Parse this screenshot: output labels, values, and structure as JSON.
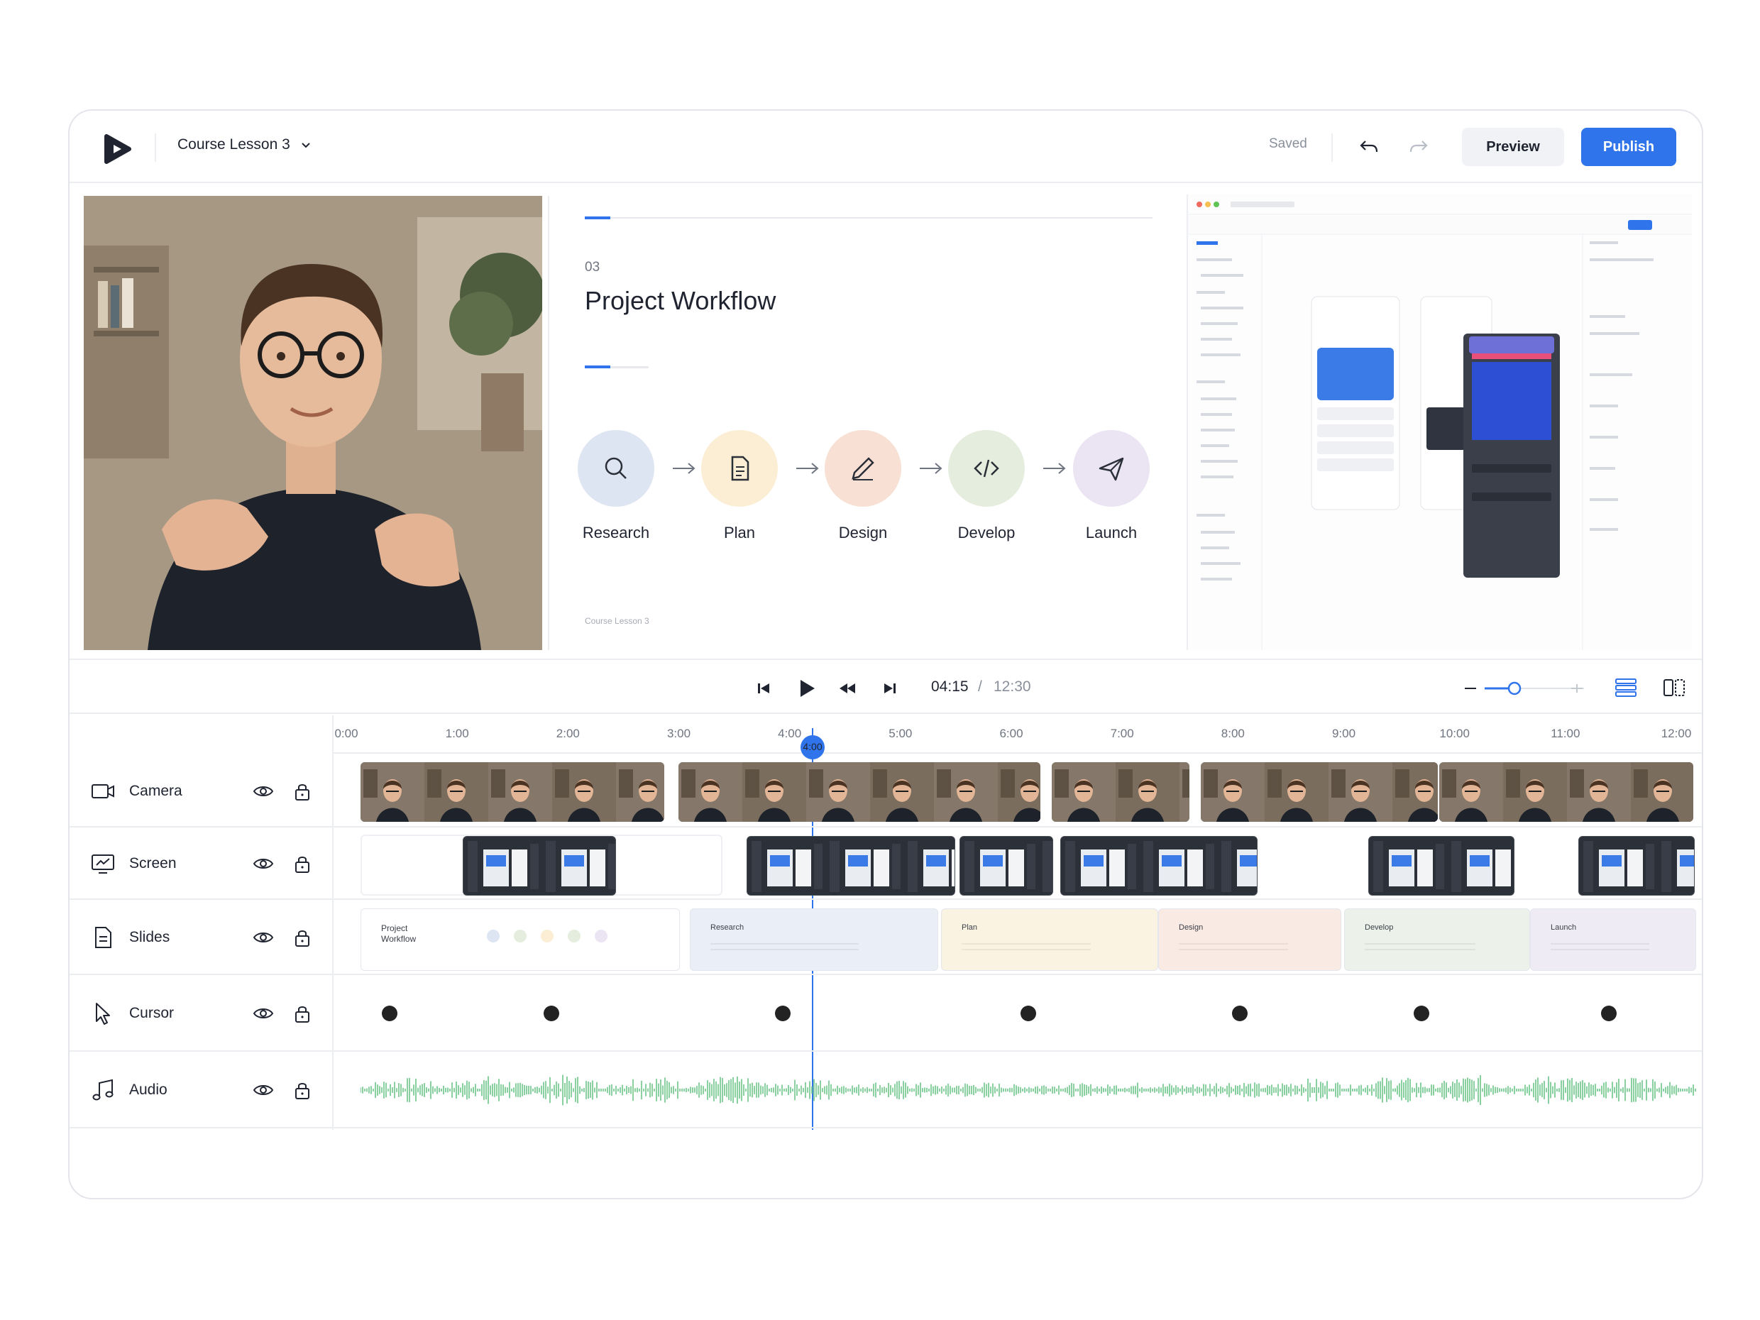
{
  "header": {
    "project_title": "Course Lesson 3",
    "saved_status": "Saved",
    "preview_label": "Preview",
    "publish_label": "Publish"
  },
  "slide": {
    "number": "03",
    "title": "Project Workflow",
    "steps": [
      {
        "label": "Research",
        "icon": "search-icon",
        "color": "#dde5f3"
      },
      {
        "label": "Plan",
        "icon": "document-icon",
        "color": "#fbeed4"
      },
      {
        "label": "Design",
        "icon": "pen-icon",
        "color": "#f8e0d5"
      },
      {
        "label": "Develop",
        "icon": "code-icon",
        "color": "#e5eddf"
      },
      {
        "label": "Launch",
        "icon": "send-icon",
        "color": "#ebe4f3"
      }
    ],
    "footer": "Course Lesson 3"
  },
  "transport": {
    "current_time": "04:15",
    "separator": "/",
    "total_time": "12:30",
    "zoom_level": 0.3
  },
  "timeline": {
    "ticks": [
      "0:00",
      "1:00",
      "2:00",
      "3:00",
      "4:00",
      "5:00",
      "6:00",
      "7:00",
      "8:00",
      "9:00",
      "10:00",
      "11:00",
      "12:00"
    ],
    "playhead_label": "4:00",
    "tracks": [
      {
        "name": "Camera",
        "icon": "video-camera-icon"
      },
      {
        "name": "Screen",
        "icon": "monitor-icon"
      },
      {
        "name": "Slides",
        "icon": "document-icon"
      },
      {
        "name": "Cursor",
        "icon": "cursor-arrow-icon"
      },
      {
        "name": "Audio",
        "icon": "music-note-icon"
      }
    ],
    "slide_clips": [
      "Project Workflow",
      "Research",
      "Plan",
      "Design",
      "Develop",
      "Launch"
    ]
  },
  "colors": {
    "accent": "#2f74ea",
    "waveform": "#6cc489",
    "playhead": "#2f74ea"
  }
}
